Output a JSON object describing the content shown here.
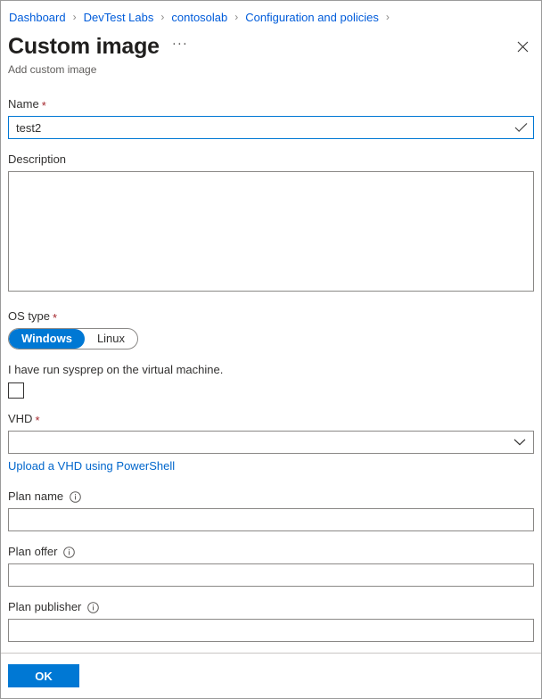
{
  "breadcrumb": {
    "items": [
      {
        "label": "Dashboard"
      },
      {
        "label": "DevTest Labs"
      },
      {
        "label": "contosolab"
      },
      {
        "label": "Configuration and policies"
      }
    ],
    "separator": "›"
  },
  "header": {
    "title": "Custom image",
    "subtitle": "Add custom image",
    "more_label": "···",
    "close_label": "Close"
  },
  "form": {
    "name": {
      "label": "Name",
      "required_marker": "*",
      "value": "test2",
      "placeholder": ""
    },
    "description": {
      "label": "Description",
      "value": "",
      "placeholder": ""
    },
    "os_type": {
      "label": "OS type",
      "required_marker": "*",
      "options": [
        {
          "label": "Windows",
          "selected": true
        },
        {
          "label": "Linux",
          "selected": false
        }
      ]
    },
    "sysprep": {
      "label": "I have run sysprep on the virtual machine.",
      "checked": false
    },
    "vhd": {
      "label": "VHD",
      "required_marker": "*",
      "value": "",
      "link_label": "Upload a VHD using PowerShell"
    },
    "plan_name": {
      "label": "Plan name",
      "value": "",
      "placeholder": "",
      "info": "info-icon"
    },
    "plan_offer": {
      "label": "Plan offer",
      "value": "",
      "placeholder": "",
      "info": "info-icon"
    },
    "plan_publisher": {
      "label": "Plan publisher",
      "value": "",
      "placeholder": "",
      "info": "info-icon"
    }
  },
  "footer": {
    "ok_label": "OK"
  },
  "colors": {
    "accent": "#0078d4",
    "link": "#015cda",
    "required": "#a4262c",
    "border": "#8a8886",
    "text": "#323130"
  }
}
